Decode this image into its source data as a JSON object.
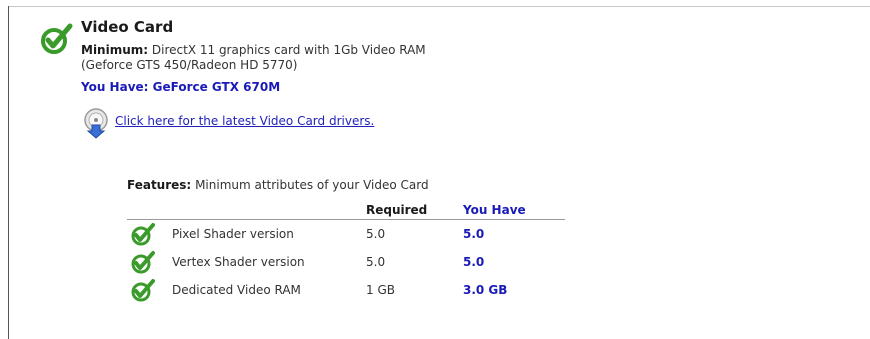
{
  "section": {
    "title": "Video Card",
    "minimum_label": "Minimum:",
    "minimum_text": "DirectX 11 graphics card with 1Gb Video RAM",
    "minimum_text_2": "(Geforce GTS 450/Radeon HD 5770)",
    "you_have": "You Have: GeForce GTX 670M",
    "driver_link": "Click here for the latest Video Card drivers."
  },
  "features": {
    "label": "Features:",
    "description": "Minimum attributes of your Video Card",
    "columns": {
      "required": "Required",
      "you_have": "You Have"
    },
    "rows": [
      {
        "name": "Pixel Shader version",
        "required": "5.0",
        "you_have": "5.0"
      },
      {
        "name": "Vertex Shader version",
        "required": "5.0",
        "you_have": "5.0"
      },
      {
        "name": "Dedicated Video RAM",
        "required": "1 GB",
        "you_have": "3.0 GB"
      }
    ]
  },
  "colors": {
    "check_green": "#3a9a2a",
    "link_blue": "#2222bb",
    "value_blue": "#1a1ab8"
  },
  "icons": {
    "section_status": "green-checkmark-icon",
    "driver": "download-icon",
    "row_status": "green-checkmark-icon"
  }
}
